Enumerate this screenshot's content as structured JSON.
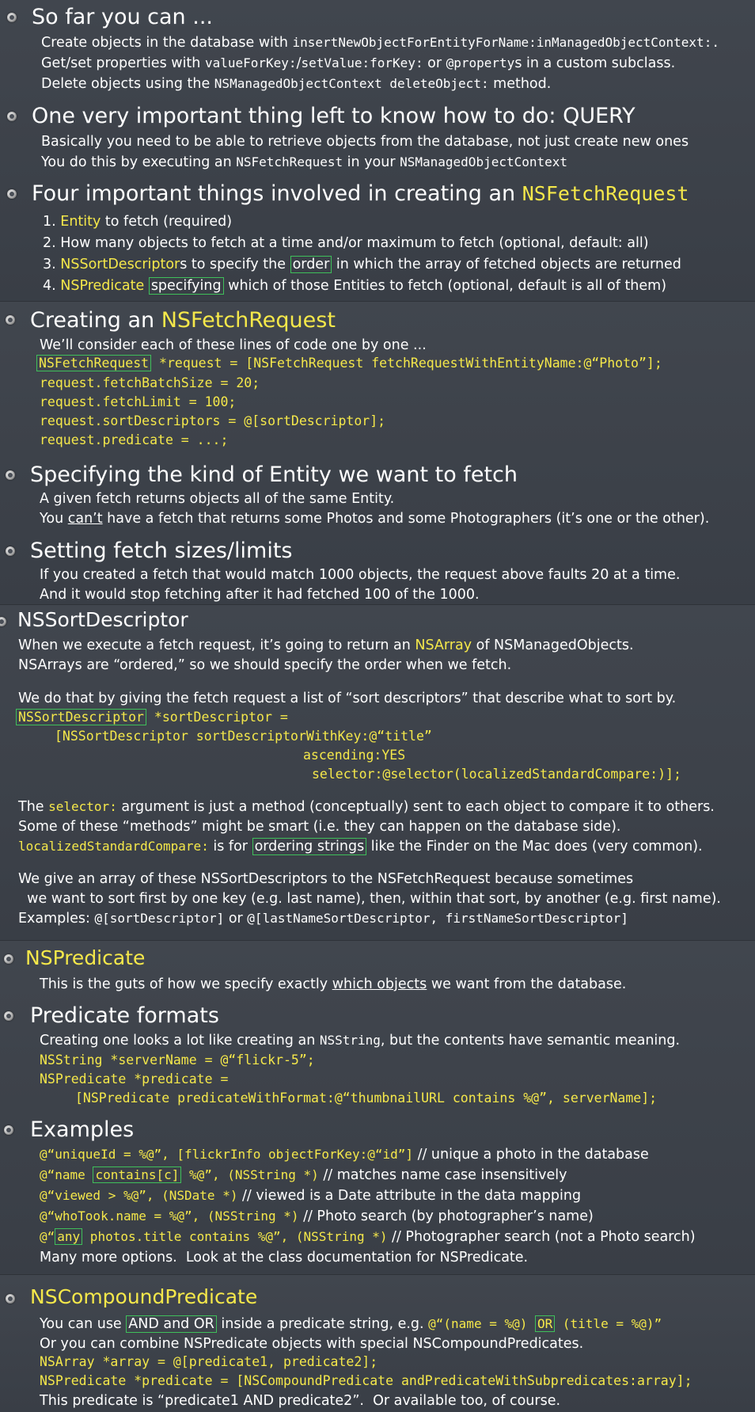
{
  "s1": {
    "h1": "So far you can ...",
    "l1a": "Create objects in the database with ",
    "l1b": "insertNewObjectForEntityForName:inManagedObjectContext:.",
    "l2a": "Get/set properties with ",
    "l2b": "valueForKey:",
    "l2c": "/",
    "l2d": "setValue:forKey:",
    "l2e": " or ",
    "l2f": "@property",
    "l2g": "s in a custom subclass.",
    "l3a": "Delete objects using the ",
    "l3b": "NSManagedObjectContext deleteObject:",
    "l3c": " method.",
    "h2": "One very important thing left to know how to do: QUERY",
    "l4": "Basically you need to be able to retrieve objects from the database, not just create new ones",
    "l5a": "You do this by executing an ",
    "l5b": "NSFetchRequest",
    "l5c": " in your ",
    "l5d": "NSManagedObjectContext",
    "h3a": "Four important things involved in creating an ",
    "h3b": "NSFetchRequest",
    "n1a": "1. ",
    "n1b": "Entity",
    "n1c": " to fetch (required)",
    "n2": "2. How many objects to fetch at a time and/or maximum to fetch (optional, default: all)",
    "n3a": "3. ",
    "n3b": "NSSortDescriptor",
    "n3c": "s to specify the ",
    "n3d": "order",
    "n3e": " in which the array of fetched objects are returned",
    "n4a": "4. ",
    "n4b": "NSPredicate",
    "n4c": " ",
    "n4d": "specifying",
    "n4e": " which of those Entities to fetch (optional, default is all of them)"
  },
  "s2": {
    "h1a": "Creating an ",
    "h1b": "NSFetchRequest",
    "p1": "We’ll consider each of these lines of code one by one ...",
    "c1a": "NSFetchRequest",
    "c1b": " *request = [NSFetchRequest fetchRequestWithEntityName:@“Photo”];",
    "c2": "request.fetchBatchSize = 20;",
    "c3": "request.fetchLimit = 100;",
    "c4": "request.sortDescriptors = @[sortDescriptor];",
    "c5": "request.predicate = ...;",
    "h2": "Specifying the kind of Entity we want to fetch",
    "p2": "A given fetch returns objects all of the same Entity.",
    "p3a": "You ",
    "p3b": "can’t",
    "p3c": " have a fetch that returns some Photos and some Photographers (it’s one or the other).",
    "h3": "Setting fetch sizes/limits",
    "p4": "If you created a fetch that would match 1000 objects, the request above faults 20 at a time.",
    "p5": "And it would stop fetching after it had fetched 100 of the 1000."
  },
  "s3": {
    "h1": "NSSortDescriptor",
    "p1a": "When we execute a fetch request, it’s going to return an ",
    "p1b": "NSArray",
    "p1c": " of NSManagedObjects.",
    "p2": "NSArrays are “ordered,” so we should specify the order when we fetch.",
    "p3": "We do that by giving the fetch request a list of “sort descriptors” that describe what to sort by.",
    "c1a": "NSSortDescriptor",
    "c1b": " *sortDescriptor =",
    "c2": "[NSSortDescriptor sortDescriptorWithKey:@“title”",
    "c3": "ascending:YES",
    "c4": "selector:@selector(localizedStandardCompare:)];",
    "p4a": "The ",
    "p4b": "selector:",
    "p4c": " argument is just a method (conceptually) sent to each object to compare it to others.",
    "p5": "Some of these “methods” might be smart (i.e. they can happen on the database side).",
    "p6a": "localizedStandardCompare:",
    "p6b": " is for ",
    "p6c": "ordering strings",
    "p6d": " like the Finder on the Mac does (very common).",
    "p7": "We give an array of these NSSortDescriptors to the NSFetchRequest because sometimes",
    "p8": "  we want to sort first by one key (e.g. last name), then, within that sort, by another (e.g. first name).",
    "p9a": "Examples: ",
    "p9b": "@[sortDescriptor]",
    "p9c": " or ",
    "p9d": "@[lastNameSortDescriptor, firstNameSortDescriptor]"
  },
  "s4": {
    "h1": "NSPredicate",
    "p1a": "This is the guts of how we specify exactly ",
    "p1b": "which objects",
    "p1c": " we want from the database.",
    "h2": "Predicate formats",
    "p2a": "Creating one looks a lot like creating an ",
    "p2b": "NSString",
    "p2c": ", but the contents have semantic meaning.",
    "c1": "NSString *serverName = @“flickr-5”;",
    "c2": "NSPredicate *predicate =",
    "c3": "[NSPredicate predicateWithFormat:@“thumbnailURL contains %@”, serverName];",
    "h3": "Examples",
    "e1a": "@“uniqueId = %@”, [flickrInfo objectForKey:@“id”]",
    "e1b": " // unique a photo in the database",
    "e2a": "@“name ",
    "e2b": "contains[c]",
    "e2c": " %@”, (NSString *)",
    "e2d": " // matches name case insensitively",
    "e3a": "@“viewed > %@”, (NSDate *)",
    "e3b": " // viewed is a Date attribute in the data mapping",
    "e4a": "@“whoTook.name = %@”, (NSString *)",
    "e4b": " // Photo search (by photographer’s name)",
    "e5a": "@“",
    "e5b": "any",
    "e5c": " photos.title contains %@”, (NSString *)",
    "e5d": " // Photographer search (not a Photo search)",
    "p3": "Many more options.  Look at the class documentation for NSPredicate."
  },
  "s5": {
    "h1": "NSCompoundPredicate",
    "p1a": "You can use ",
    "p1b": "AND and OR",
    "p1c": " inside a predicate string, e.g. ",
    "p1d": "@“(name = %@) ",
    "p1e": "OR",
    "p1f": " (title = %@)”",
    "p2": "Or you can combine NSPredicate objects with special NSCompoundPredicates.",
    "c1": "NSArray *array = @[predicate1, predicate2];",
    "c2": "NSPredicate *predicate = [NSCompoundPredicate andPredicateWithSubpredicates:array];",
    "p3": "This predicate is “predicate1 AND predicate2”.  Or available too, of course."
  }
}
